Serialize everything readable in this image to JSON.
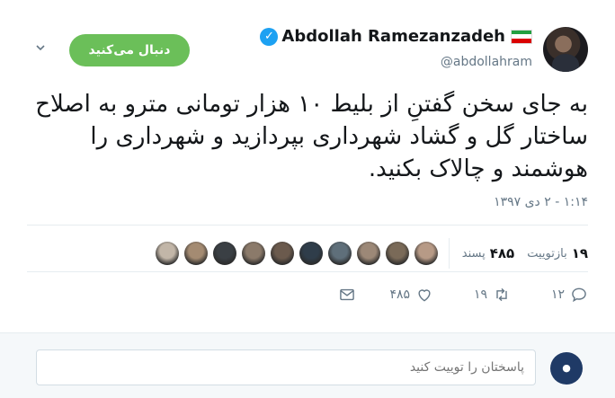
{
  "author": {
    "display_name": "Abdollah Ramezanzadeh",
    "handle": "@abdollahram",
    "verified_icon": "verified-badge-icon",
    "flag": "iran-flag"
  },
  "follow_button": {
    "label": "دنبال می‌کنید"
  },
  "tweet": {
    "text": "به جای سخن گفتنِ از بلیط ۱۰ هزار تومانی مترو به اصلاح ساختار گل و گشاد شهرداری بپردازید و شهرداری را هوشمند و چالاک بکنید.",
    "timestamp": "۱:۱۴ - ۲ دی ۱۳۹۷"
  },
  "stats": {
    "retweets_count": "۱۹",
    "retweets_label": "بازتوییت",
    "likes_count": "۴۸۵",
    "likes_label": "پسند"
  },
  "actions": {
    "reply_count": "۱۲",
    "retweet_count": "۱۹",
    "like_count": "۴۸۵"
  },
  "reply_box": {
    "placeholder": "پاسختان را توییت کنید"
  },
  "colors": {
    "follow_green": "#6bbf59",
    "verified_blue": "#1da1f2",
    "text_gray": "#657786",
    "divider": "#e6ecf0",
    "reply_bg": "#f5f8fa"
  },
  "liker_faces": [
    "#b79a86",
    "#7a6a58",
    "#9c8877",
    "#5f6f7a",
    "#2f3d4a",
    "#6b5a4d",
    "#8b7a6a",
    "#3a3f44",
    "#a48b72",
    "#c2b6a8"
  ]
}
